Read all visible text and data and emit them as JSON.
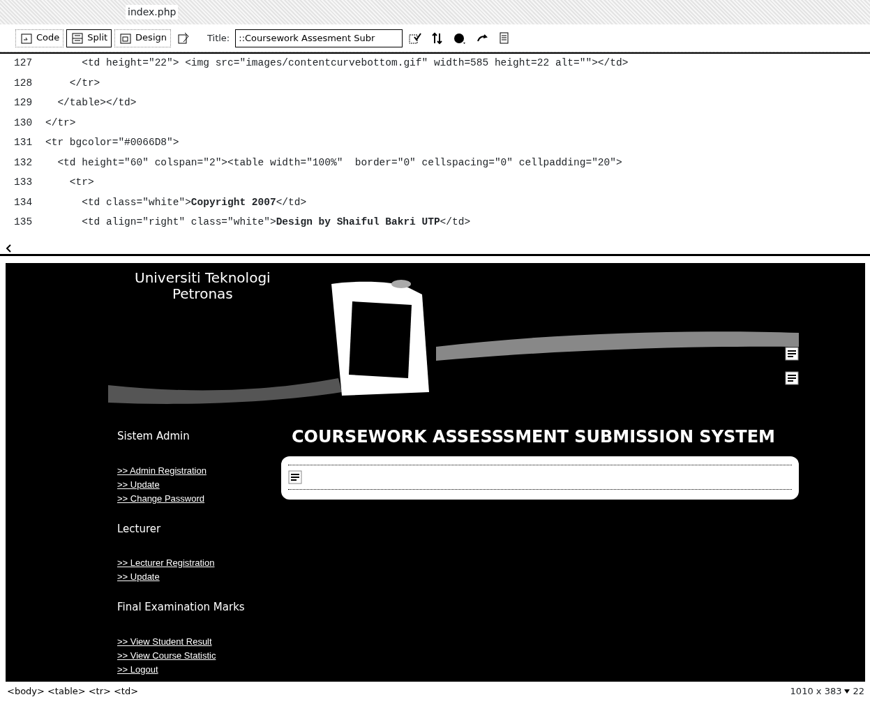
{
  "window": {
    "title": "index.php"
  },
  "toolbar": {
    "view_buttons": [
      {
        "label": "Code",
        "selected": false
      },
      {
        "label": "Split",
        "selected": true
      },
      {
        "label": "Design",
        "selected": false
      }
    ],
    "title_label": "Title:",
    "title_value": "::Coursework Assesment Subr"
  },
  "code_lines": [
    {
      "number": "127",
      "text": "      <td height=\"22\"> <img src=\"images/contentcurvebottom.gif\" width=585 height=22 alt=\"\"></td>"
    },
    {
      "number": "128",
      "text": "    </tr>"
    },
    {
      "number": "129",
      "text": "  </table></td>"
    },
    {
      "number": "130",
      "text": "</tr>"
    },
    {
      "number": "131",
      "text": "<tr bgcolor=\"#0066D8\">"
    },
    {
      "number": "132",
      "text": "  <td height=\"60\" colspan=\"2\"><table width=\"100%\"  border=\"0\" cellspacing=\"0\" cellpadding=\"20\">"
    },
    {
      "number": "133",
      "text": "    <tr>"
    },
    {
      "number": "134",
      "text": "      <td class=\"white\">**Copyright 2007**</td>"
    },
    {
      "number": "135",
      "text": "      <td align=\"right\" class=\"white\">**Design by Shaiful Bakri UTP**</td>"
    }
  ],
  "design": {
    "banner": {
      "kind": "picture"
    },
    "logo": [
      "Universiti Teknologi",
      "Petronas"
    ],
    "sidebar": [
      {
        "heading": "Sistem Admin",
        "links": [
          ">> Admin Registration",
          ">> Update",
          ">> Change Password"
        ]
      },
      {
        "heading": "Lecturer",
        "links": [
          ">> Lecturer Registration",
          ">> Update"
        ]
      },
      {
        "heading": "Final Examination Marks",
        "links": [
          ">> View Student Result",
          ">> View Course Statistic",
          ">> Logout"
        ]
      }
    ],
    "heading": "COURSEWORK ASSESSSMENT SUBMISSION SYSTEM"
  },
  "status_bar": {
    "tags": [
      "<body>",
      "<table>",
      "<tr>",
      "<td>"
    ],
    "size": "1010 x 383",
    "zoom": "22"
  }
}
